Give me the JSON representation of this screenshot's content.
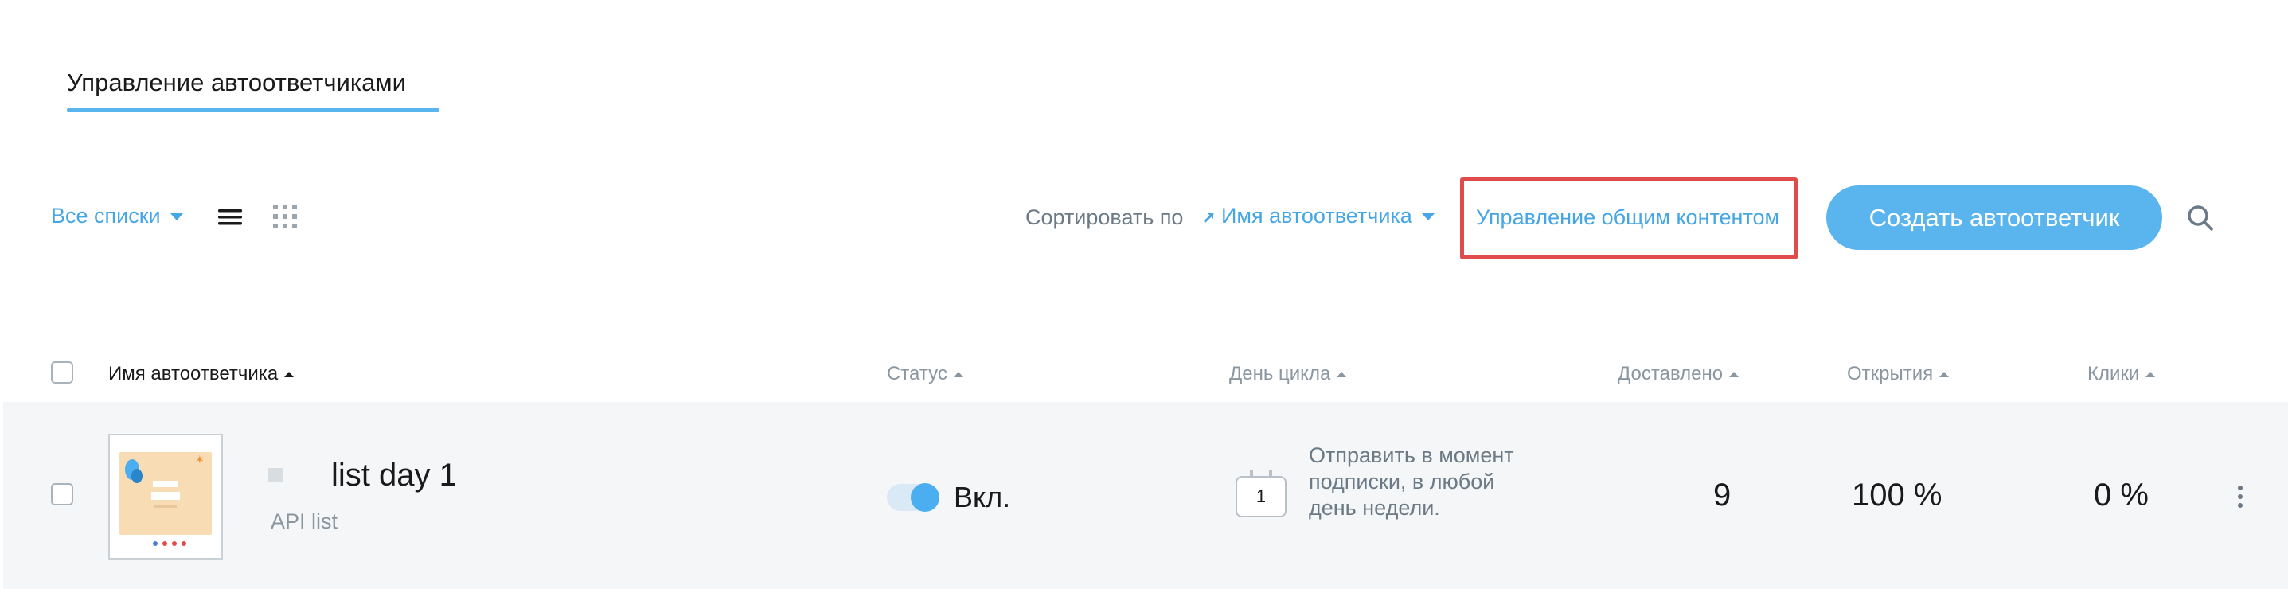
{
  "header": {
    "tab_title": "Управление автоответчиками"
  },
  "toolbar": {
    "all_lists": "Все списки",
    "sort_label": "Сортировать по",
    "sort_value": "Имя автоответчика",
    "manage_content": "Управление общим контентом",
    "create_button": "Создать автоответчик",
    "view_icons": [
      "list-view-icon",
      "grid-view-icon"
    ],
    "search_icon": "search-icon"
  },
  "table": {
    "columns": {
      "name": "Имя автоответчика",
      "status": "Статус",
      "cycle_day": "День цикла",
      "delivered": "Доставлено",
      "opens": "Открытия",
      "clicks": "Клики"
    },
    "rows": [
      {
        "title": "list day 1",
        "list": "API list",
        "status_label": "Вкл.",
        "status_on": true,
        "cycle_day_number": "1",
        "cycle_text": "Отправить в момент подписки, в любой день недели.",
        "delivered": "9",
        "opens": "100 %",
        "clicks": "0 %"
      }
    ]
  },
  "colors": {
    "accent": "#5ab4ee",
    "link": "#45a6e6",
    "highlight_box": "#e04b4b",
    "row_background": "#f4f6f8"
  }
}
